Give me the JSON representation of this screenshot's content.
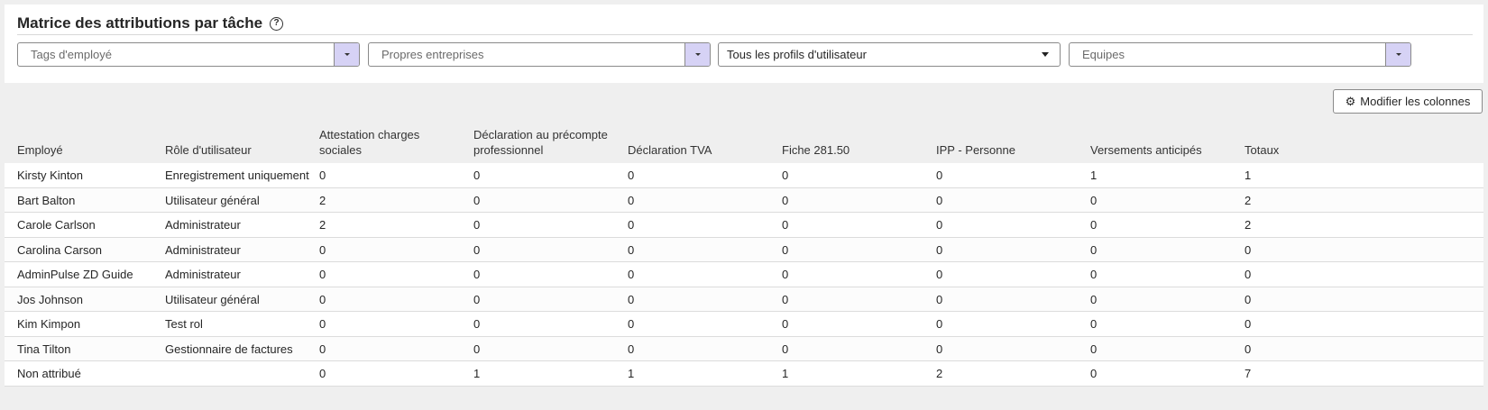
{
  "header": {
    "title": "Matrice des attributions par tâche",
    "help_icon": "question-circle-icon"
  },
  "filters": [
    {
      "name": "filter-employee-tags",
      "placeholder": "Tags d'employé",
      "selected": false
    },
    {
      "name": "filter-own-companies",
      "placeholder": "Propres entreprises",
      "selected": false
    },
    {
      "name": "filter-user-profiles",
      "placeholder": "Tous les profils d'utilisateur",
      "selected": true
    },
    {
      "name": "filter-teams",
      "placeholder": "Equipes",
      "selected": false
    }
  ],
  "toolbar": {
    "modify_columns_label": "Modifier les colonnes",
    "icon": "gear-icon"
  },
  "table": {
    "columns": [
      "Employé",
      "Rôle d'utilisateur",
      "Attestation charges sociales",
      "Déclaration au précompte professionnel",
      "Déclaration TVA",
      "Fiche 281.50",
      "IPP - Personne",
      "Versements anticipés",
      "Totaux"
    ],
    "rows": [
      [
        "Kirsty Kinton",
        "Enregistrement uniquement",
        "0",
        "0",
        "0",
        "0",
        "0",
        "1",
        "1"
      ],
      [
        "Bart Balton",
        "Utilisateur général",
        "2",
        "0",
        "0",
        "0",
        "0",
        "0",
        "2"
      ],
      [
        "Carole Carlson",
        "Administrateur",
        "2",
        "0",
        "0",
        "0",
        "0",
        "0",
        "2"
      ],
      [
        "Carolina Carson",
        "Administrateur",
        "0",
        "0",
        "0",
        "0",
        "0",
        "0",
        "0"
      ],
      [
        "AdminPulse ZD Guide",
        "Administrateur",
        "0",
        "0",
        "0",
        "0",
        "0",
        "0",
        "0"
      ],
      [
        "Jos Johnson",
        "Utilisateur général",
        "0",
        "0",
        "0",
        "0",
        "0",
        "0",
        "0"
      ],
      [
        "Kim Kimpon",
        "Test rol",
        "0",
        "0",
        "0",
        "0",
        "0",
        "0",
        "0"
      ],
      [
        "Tina Tilton",
        "Gestionnaire de factures",
        "0",
        "0",
        "0",
        "0",
        "0",
        "0",
        "0"
      ],
      [
        "Non attribué",
        "",
        "0",
        "1",
        "1",
        "1",
        "2",
        "0",
        "7"
      ]
    ]
  }
}
